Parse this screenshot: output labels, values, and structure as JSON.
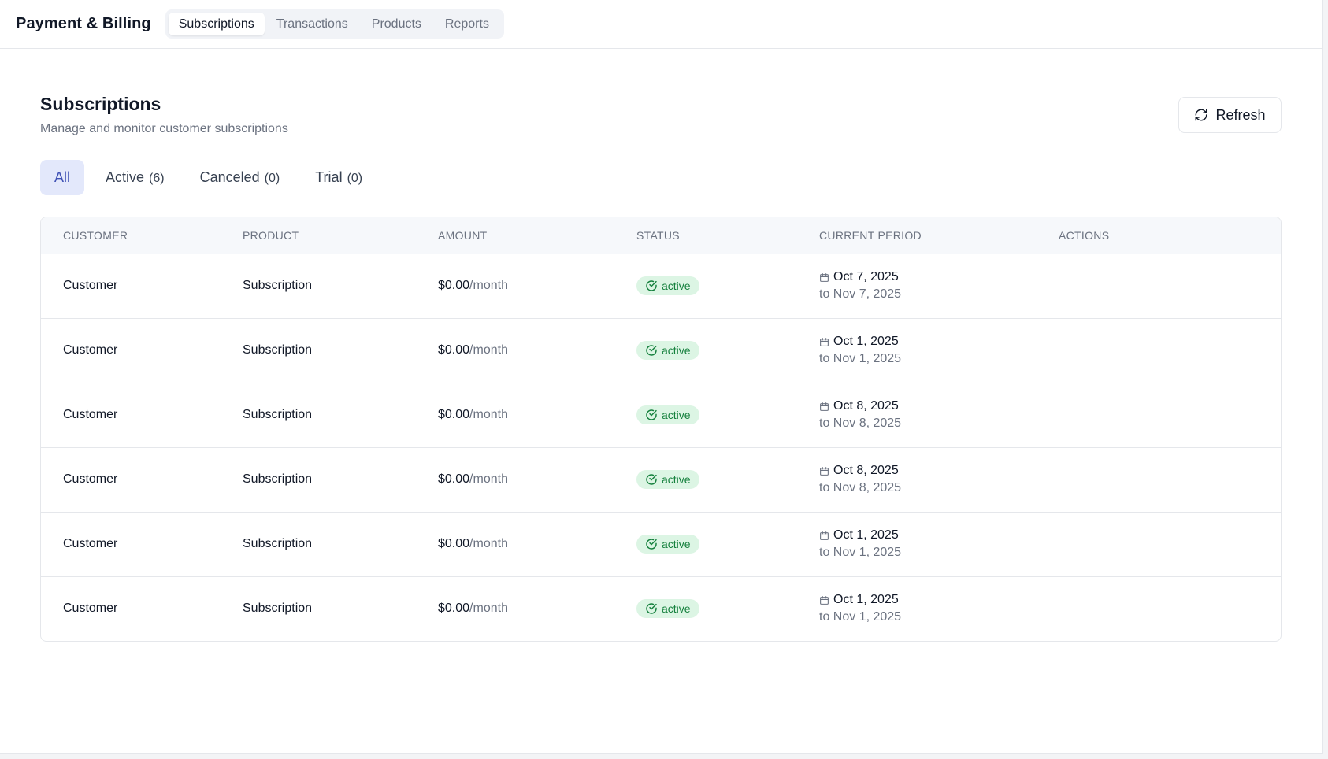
{
  "app": {
    "title": "Payment & Billing",
    "tabs": [
      {
        "label": "Subscriptions",
        "active": true
      },
      {
        "label": "Transactions",
        "active": false
      },
      {
        "label": "Products",
        "active": false
      },
      {
        "label": "Reports",
        "active": false
      }
    ]
  },
  "page": {
    "title": "Subscriptions",
    "subtitle": "Manage and monitor customer subscriptions",
    "refresh_label": "Refresh",
    "refresh_icon": "refresh-icon"
  },
  "filters": [
    {
      "label": "All",
      "count": "",
      "active": true
    },
    {
      "label": "Active",
      "count": "(6)",
      "active": false
    },
    {
      "label": "Canceled",
      "count": "(0)",
      "active": false
    },
    {
      "label": "Trial",
      "count": "(0)",
      "active": false
    }
  ],
  "table": {
    "columns": [
      "CUSTOMER",
      "PRODUCT",
      "AMOUNT",
      "STATUS",
      "CURRENT PERIOD",
      "ACTIONS"
    ],
    "rows": [
      {
        "customer": "Customer",
        "product": "Subscription",
        "amount": "$0.00",
        "unit": "/month",
        "status": "active",
        "period_start": "Oct 7, 2025",
        "period_end": "to Nov 7, 2025"
      },
      {
        "customer": "Customer",
        "product": "Subscription",
        "amount": "$0.00",
        "unit": "/month",
        "status": "active",
        "period_start": "Oct 1, 2025",
        "period_end": "to Nov 1, 2025"
      },
      {
        "customer": "Customer",
        "product": "Subscription",
        "amount": "$0.00",
        "unit": "/month",
        "status": "active",
        "period_start": "Oct 8, 2025",
        "period_end": "to Nov 8, 2025"
      },
      {
        "customer": "Customer",
        "product": "Subscription",
        "amount": "$0.00",
        "unit": "/month",
        "status": "active",
        "period_start": "Oct 8, 2025",
        "period_end": "to Nov 8, 2025"
      },
      {
        "customer": "Customer",
        "product": "Subscription",
        "amount": "$0.00",
        "unit": "/month",
        "status": "active",
        "period_start": "Oct 1, 2025",
        "period_end": "to Nov 1, 2025"
      },
      {
        "customer": "Customer",
        "product": "Subscription",
        "amount": "$0.00",
        "unit": "/month",
        "status": "active",
        "period_start": "Oct 1, 2025",
        "period_end": "to Nov 1, 2025"
      }
    ]
  },
  "colors": {
    "active_tab_bg": "#ffffff",
    "filter_active_bg": "#e3e8fb",
    "filter_active_text": "#3f51b5",
    "status_active_bg": "#dcf5e4",
    "status_active_text": "#15803d"
  }
}
